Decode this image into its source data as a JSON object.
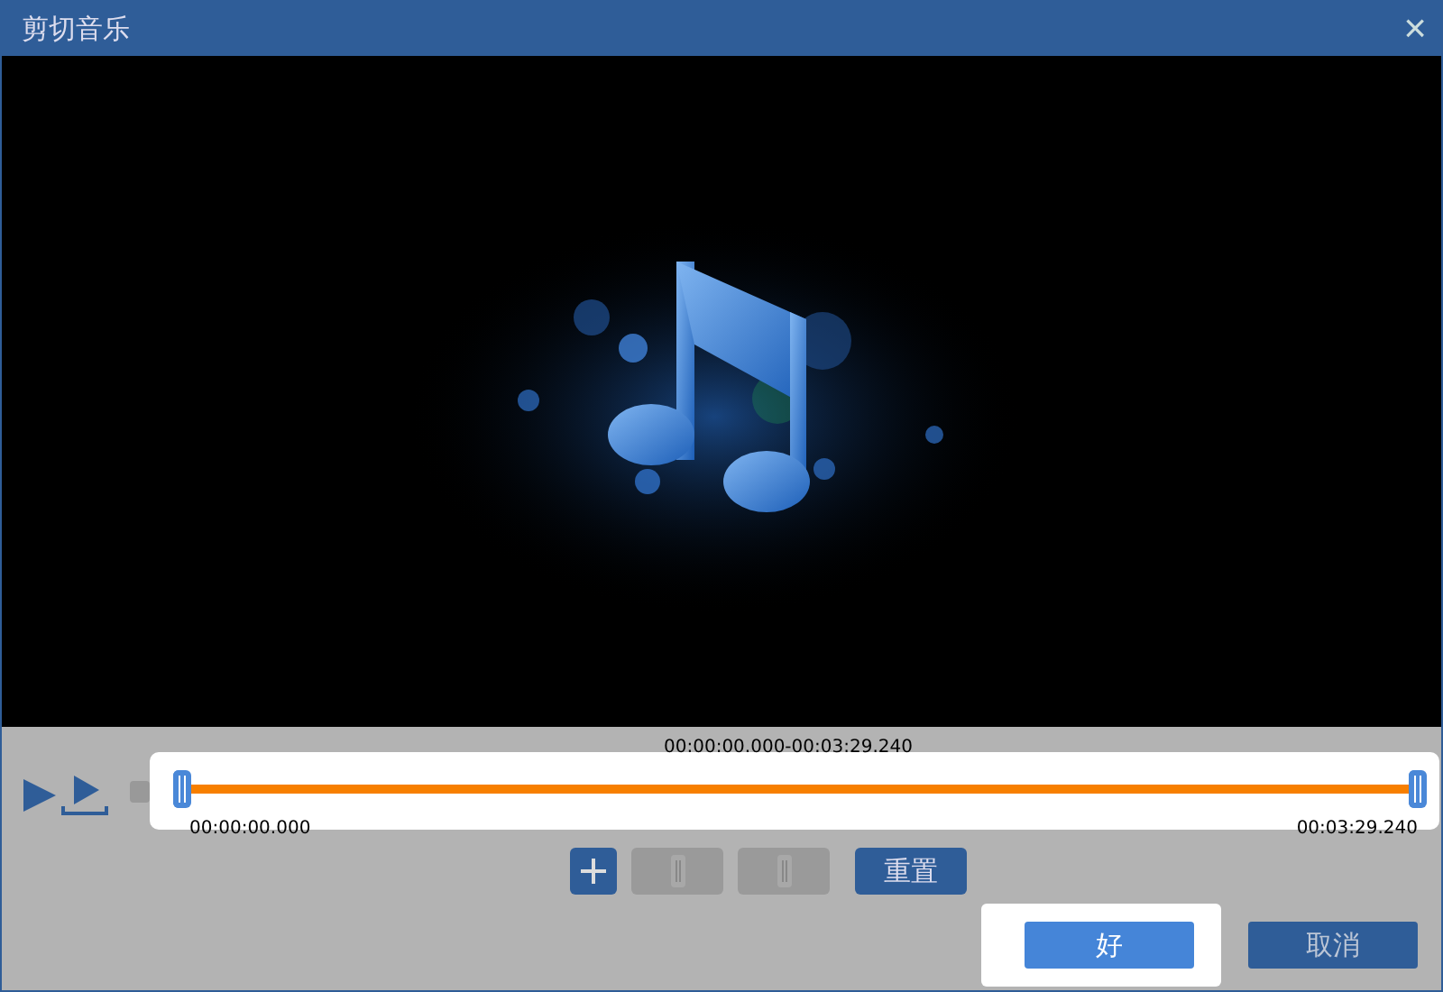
{
  "window": {
    "title": "剪切音乐",
    "close": "×"
  },
  "timeline": {
    "range": "00:00:00.000-00:03:29.240",
    "start_time": "00:00:00.000",
    "end_time": "00:03:29.240",
    "start_handle": {
      "level": 0
    },
    "end_handle": {
      "level": 1
    }
  },
  "edit_buttons": [
    {
      "kind": "add",
      "disabled": false
    },
    {
      "kind": "mark-in",
      "disabled": true
    },
    {
      "kind": "mark-out",
      "disabled": true
    },
    {
      "kind": "text",
      "label": "重置",
      "disabled": false
    }
  ],
  "footer_buttons": [
    {
      "label": "好",
      "selected": true
    },
    {
      "label": "取消",
      "selected": false
    }
  ]
}
